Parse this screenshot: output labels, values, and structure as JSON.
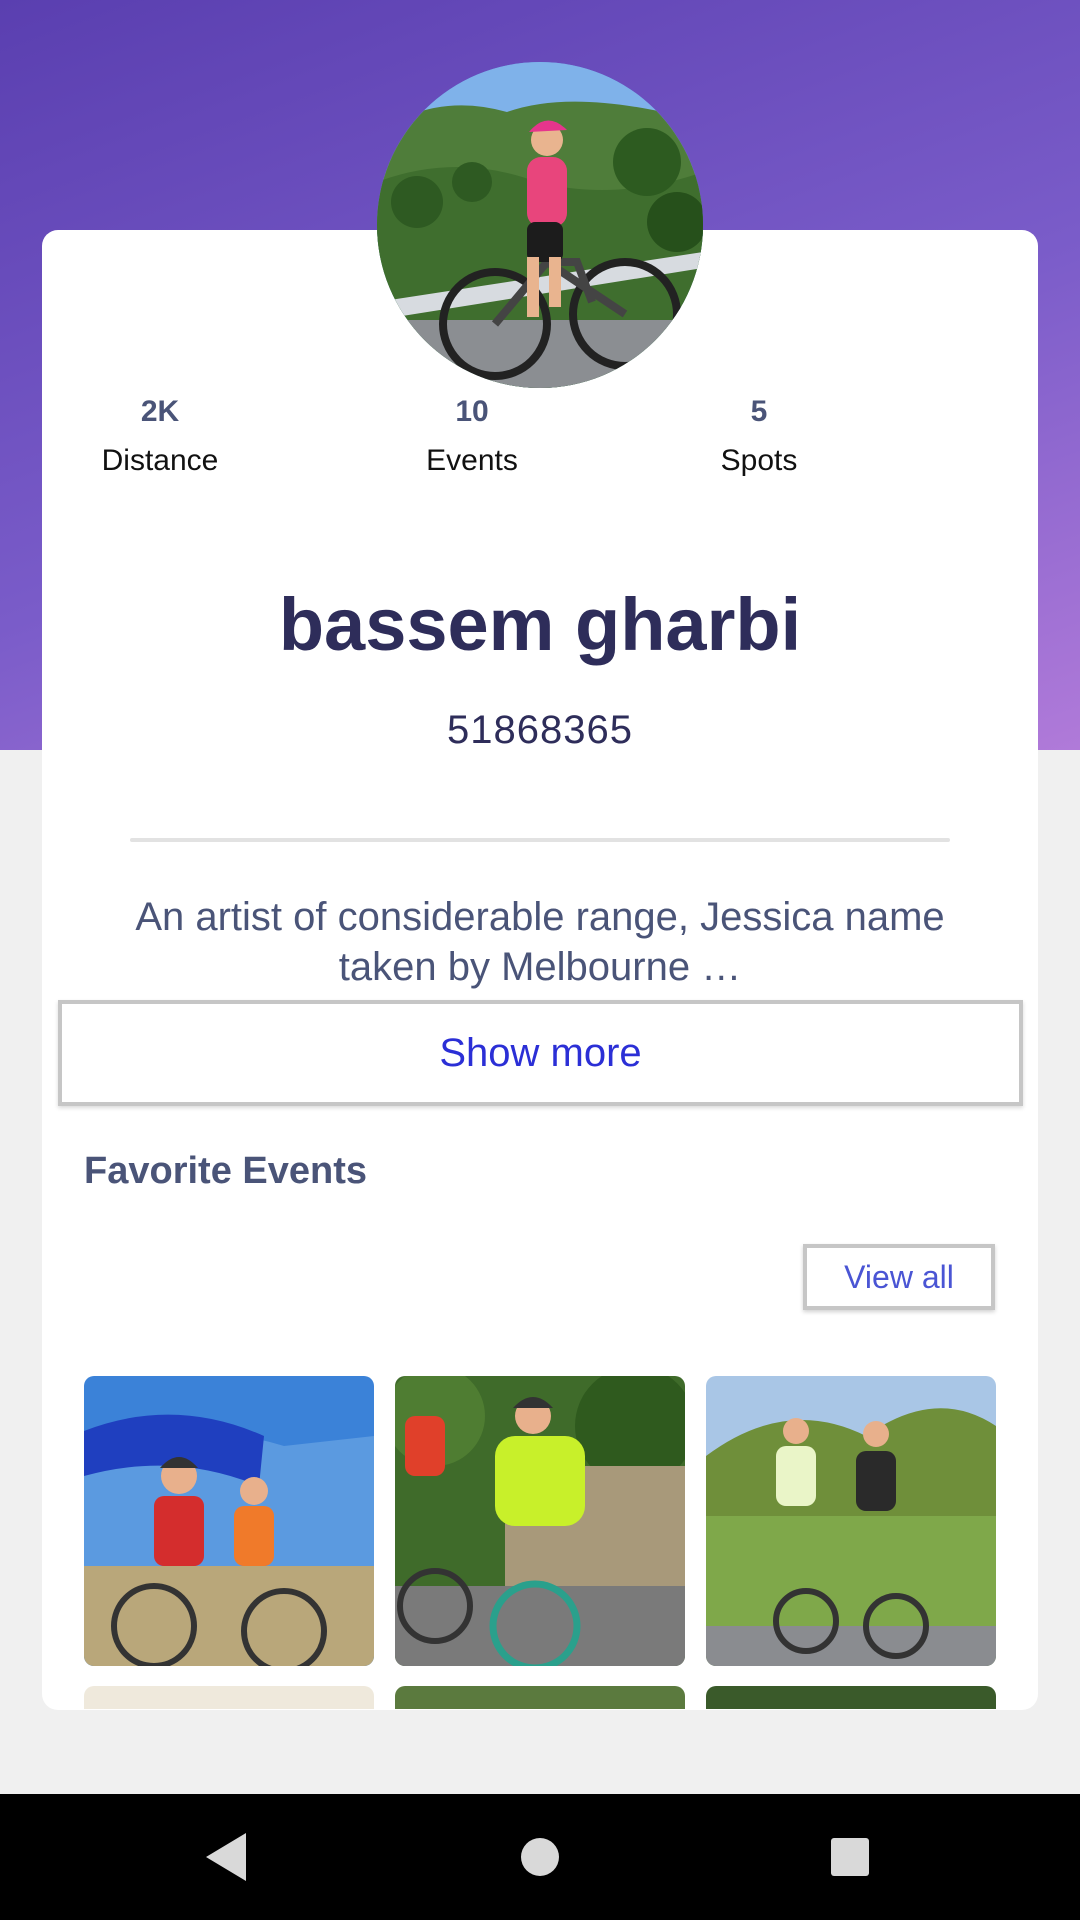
{
  "profile": {
    "name": "bassem gharbi",
    "phone": "51868365",
    "bio": "An artist of considerable range, Jessica name taken by Melbourne …",
    "avatar_icon": "cyclist-avatar-photo"
  },
  "stats": [
    {
      "value": "2K",
      "label": "Distance"
    },
    {
      "value": "10",
      "label": "Events"
    },
    {
      "value": "5",
      "label": "Spots"
    }
  ],
  "actions": {
    "show_more_label": "Show more",
    "view_all_label": "View all"
  },
  "favorites": {
    "title": "Favorite Events",
    "images": [
      "cycling-event-photo",
      "cycling-event-photo",
      "cycling-event-photo",
      "cycling-event-photo",
      "cycling-event-photo",
      "cycling-event-photo"
    ]
  },
  "nav": {
    "back_icon": "back-triangle-icon",
    "home_icon": "home-circle-icon",
    "recents_icon": "recents-square-icon"
  },
  "colors": {
    "header_gradient_start": "#5a3fb0",
    "header_gradient_end": "#b07ad9",
    "name_color": "#2e2d5a",
    "link_color": "#2b2fd6"
  }
}
